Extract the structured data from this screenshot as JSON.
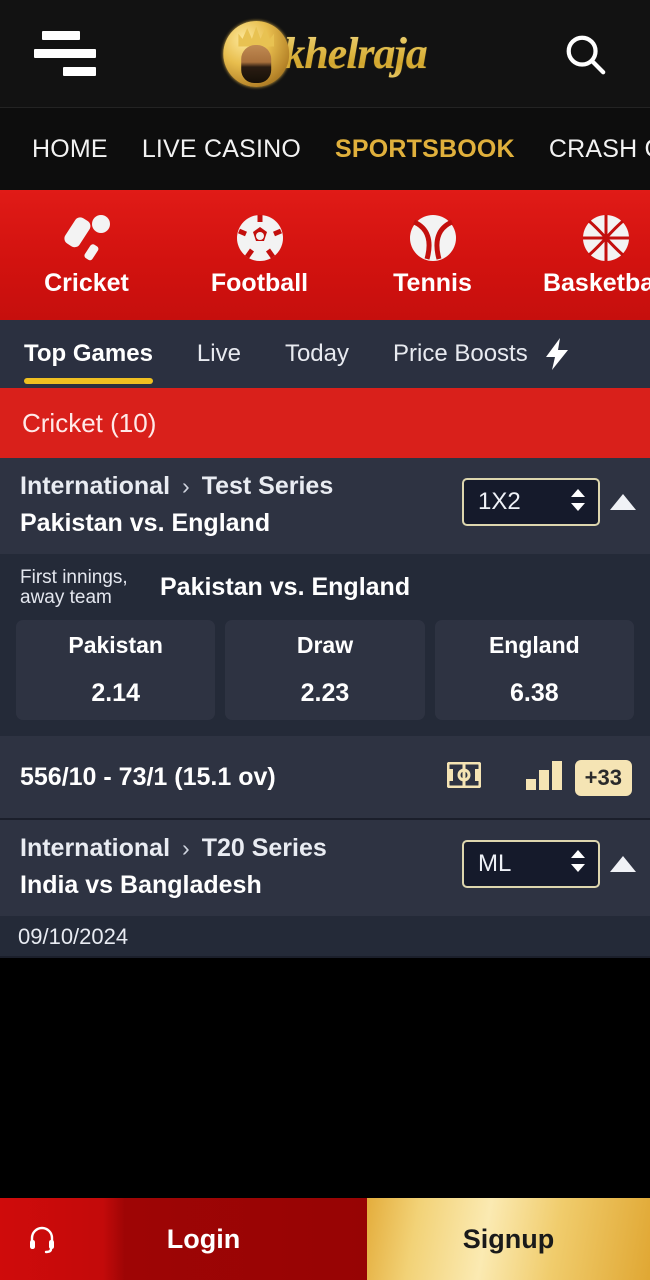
{
  "header": {
    "menu_icon": "hamburger-icon",
    "brand": "khelraja",
    "search_icon": "search-icon"
  },
  "nav": {
    "items": [
      {
        "label": "HOME",
        "active": false
      },
      {
        "label": "LIVE CASINO",
        "active": false
      },
      {
        "label": "SPORTSBOOK",
        "active": true
      },
      {
        "label": "CRASH GAMES",
        "active": false
      }
    ]
  },
  "sports": {
    "items": [
      {
        "label": "Cricket",
        "icon": "cricket-bat-ball-icon"
      },
      {
        "label": "Football",
        "icon": "football-icon"
      },
      {
        "label": "Tennis",
        "icon": "tennis-ball-icon"
      },
      {
        "label": "Basketball",
        "icon": "basketball-icon"
      }
    ]
  },
  "tabs": {
    "items": [
      {
        "label": "Top Games",
        "active": true
      },
      {
        "label": "Live",
        "active": false
      },
      {
        "label": "Today",
        "active": false
      },
      {
        "label": "Price Boosts",
        "active": false
      }
    ],
    "boost_icon": "lightning-bolt-icon"
  },
  "sport_header": {
    "title": "Cricket (10)"
  },
  "matches": [
    {
      "league_root": "International",
      "league_sep": "›",
      "league_sub": "Test Series",
      "teams": "Pakistan vs. England",
      "market_value": "1X2",
      "collapse_icon": "collapse-up-arrow-icon",
      "innings_note": "First innings, away team",
      "market_title": "Pakistan vs. England",
      "outcomes": [
        {
          "name": "Pakistan",
          "odds": "2.14"
        },
        {
          "name": "Draw",
          "odds": "2.23"
        },
        {
          "name": "England",
          "odds": "6.38"
        }
      ],
      "score": "556/10 - 73/1 (15.1 ov)",
      "icons": [
        {
          "name": "pitch-field-icon"
        },
        {
          "name": "stats-bar-chart-icon"
        }
      ],
      "more_markets": "+33"
    },
    {
      "league_root": "International",
      "league_sep": "›",
      "league_sub": "T20 Series",
      "teams": "India vs Bangladesh",
      "market_value": "ML",
      "collapse_icon": "collapse-up-arrow-icon",
      "date": "09/10/2024"
    }
  ],
  "bottom_bar": {
    "support_icon": "headset-icon",
    "login_label": "Login",
    "signup_label": "Signup"
  },
  "colors": {
    "brand_gold": "#e0b03c",
    "brand_red": "#d2120f",
    "card_bg": "#2e3342",
    "panel_bg": "#242a38",
    "tab_bar_bg": "#2b3040",
    "accent_yellow": "#f0c021",
    "badge_cream": "#f5e4b4"
  }
}
